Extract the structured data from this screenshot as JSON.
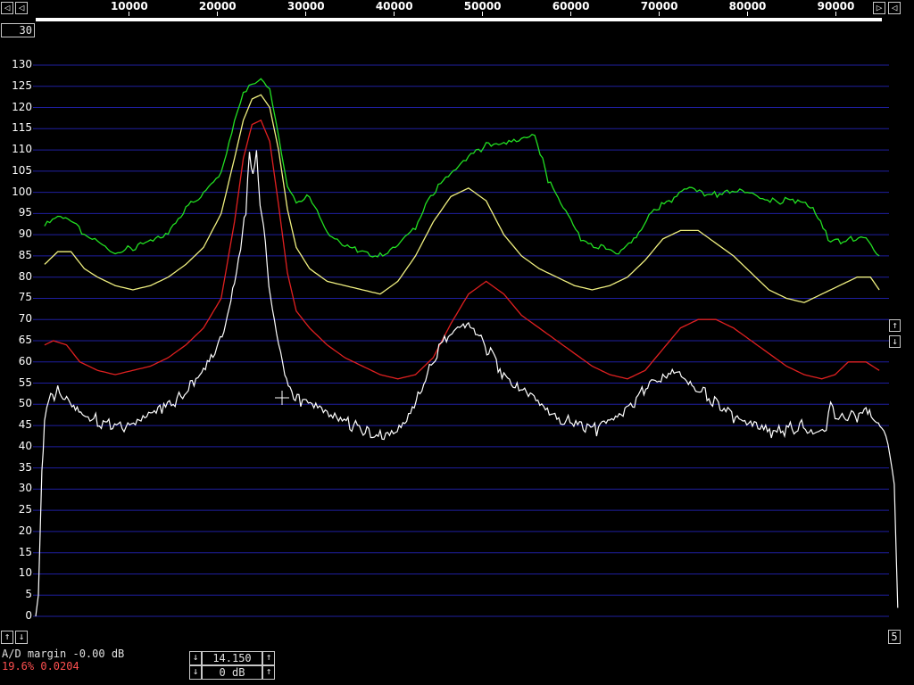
{
  "x_axis": {
    "ticks": [
      "10000",
      "20000",
      "30000",
      "40000",
      "50000",
      "60000",
      "70000",
      "80000",
      "90000"
    ],
    "min": 0,
    "max": 96000
  },
  "y_axis": {
    "ticks": [
      "130",
      "125",
      "120",
      "115",
      "110",
      "105",
      "100",
      "95",
      "90",
      "85",
      "80",
      "75",
      "70",
      "65",
      "60",
      "55",
      "50",
      "45",
      "40",
      "35",
      "30",
      "25",
      "20",
      "15",
      "10",
      "5",
      "0"
    ],
    "min": 0,
    "max": 130
  },
  "toolbar": {
    "left_arrow": "◁",
    "right_arrow": "▷",
    "scroll_left": "◁",
    "zoom_label": "30",
    "up_arrow": "↑",
    "down_arrow": "↓",
    "bottom_right_label": "5"
  },
  "status": {
    "line1": "A/D margin -0.00 dB",
    "line2": "19.6% 0.0204"
  },
  "controls": {
    "value1": "14.150",
    "value2": "0 dB"
  },
  "colors": {
    "grid": "#1f1fa0",
    "green": "#22e022",
    "yellow": "#f0f080",
    "red": "#e02020",
    "white": "#ffffff"
  },
  "chart_data": {
    "type": "line",
    "xlim": [
      0,
      96000
    ],
    "ylim": [
      0,
      130
    ],
    "grid": true,
    "series": [
      {
        "color": "#22e022",
        "x": [
          1000,
          2500,
          4000,
          5500,
          7000,
          9000,
          11000,
          13000,
          15000,
          17000,
          19000,
          21000,
          22500,
          23500,
          24500,
          25500,
          26500,
          27500,
          28500,
          29500,
          31000,
          33000,
          35000,
          37000,
          39000,
          41000,
          43000,
          45000,
          47000,
          49000,
          51000,
          53000,
          55000,
          56500,
          58000,
          60000,
          62000,
          64000,
          66000,
          68000,
          70000,
          72000,
          74000,
          76000,
          78000,
          80000,
          82000,
          84000,
          86000,
          88000,
          90000,
          92000,
          94000,
          95500
        ],
        "y": [
          92,
          94,
          93,
          90,
          89,
          86,
          87,
          88,
          90,
          96,
          100,
          105,
          117,
          124,
          125,
          126,
          124,
          113,
          102,
          98,
          99,
          90,
          87,
          86,
          85,
          88,
          92,
          100,
          104,
          108,
          111,
          112,
          113,
          114,
          103,
          95,
          88,
          87,
          86,
          90,
          96,
          98,
          101,
          99,
          100,
          101,
          99,
          98,
          98,
          96,
          88,
          89,
          90,
          85
        ]
      },
      {
        "color": "#f0f080",
        "x": [
          1000,
          2500,
          4000,
          5500,
          7000,
          9000,
          11000,
          13000,
          15000,
          17000,
          19000,
          21000,
          22500,
          23500,
          24500,
          25500,
          26500,
          27500,
          28500,
          29500,
          31000,
          33000,
          35000,
          37000,
          39000,
          41000,
          43000,
          45000,
          47000,
          49000,
          51000,
          53000,
          55000,
          57000,
          59000,
          61000,
          63000,
          65000,
          67000,
          69000,
          71000,
          73000,
          75000,
          77000,
          79000,
          81000,
          83000,
          85000,
          87000,
          89000,
          91000,
          93000,
          94500,
          95500
        ],
        "y": [
          83,
          86,
          86,
          82,
          80,
          78,
          77,
          78,
          80,
          83,
          87,
          95,
          108,
          117,
          122,
          123,
          120,
          110,
          96,
          87,
          82,
          79,
          78,
          77,
          76,
          79,
          85,
          93,
          99,
          101,
          98,
          90,
          85,
          82,
          80,
          78,
          77,
          78,
          80,
          84,
          89,
          91,
          91,
          88,
          85,
          81,
          77,
          75,
          74,
          76,
          78,
          80,
          80,
          77
        ]
      },
      {
        "color": "#e02020",
        "x": [
          1000,
          2000,
          3500,
          5000,
          7000,
          9000,
          11000,
          13000,
          15000,
          17000,
          19000,
          21000,
          22500,
          23500,
          24500,
          25500,
          26500,
          27500,
          28500,
          29500,
          31000,
          33000,
          35000,
          37000,
          39000,
          41000,
          43000,
          45000,
          47000,
          49000,
          51000,
          53000,
          55000,
          57000,
          59000,
          61000,
          63000,
          65000,
          67000,
          69000,
          71000,
          73000,
          75000,
          77000,
          79000,
          81000,
          83000,
          85000,
          87000,
          89000,
          90500,
          92000,
          94000,
          95500
        ],
        "y": [
          64,
          65,
          64,
          60,
          58,
          57,
          58,
          59,
          61,
          64,
          68,
          75,
          93,
          108,
          116,
          117,
          112,
          97,
          81,
          72,
          68,
          64,
          61,
          59,
          57,
          56,
          57,
          61,
          69,
          76,
          79,
          76,
          71,
          68,
          65,
          62,
          59,
          57,
          56,
          58,
          63,
          68,
          70,
          70,
          68,
          65,
          62,
          59,
          57,
          56,
          57,
          60,
          60,
          58
        ]
      },
      {
        "color": "#ffffff",
        "x": [
          0,
          300,
          700,
          1000,
          1500,
          2500,
          3500,
          4500,
          5500,
          7000,
          8500,
          10000,
          11500,
          13000,
          14500,
          16000,
          17500,
          19000,
          20500,
          21500,
          22500,
          23200,
          23800,
          24200,
          24600,
          25000,
          25400,
          25800,
          26200,
          26800,
          27500,
          28200,
          29000,
          30000,
          31500,
          33000,
          34500,
          36000,
          37500,
          39000,
          40500,
          42000,
          43500,
          45000,
          46500,
          48000,
          49000,
          50000,
          51500,
          53000,
          54500,
          56000,
          57500,
          59000,
          60500,
          62000,
          63500,
          65000,
          66500,
          68000,
          69500,
          71000,
          72500,
          73500,
          74500,
          76000,
          77500,
          79000,
          80500,
          82000,
          83500,
          85000,
          86500,
          88000,
          89500,
          90000,
          90500,
          91500,
          93000,
          94000,
          95000,
          95800,
          96500,
          97200,
          97600
        ],
        "y": [
          0,
          5,
          33,
          45,
          51,
          53,
          52,
          50,
          48,
          46,
          45,
          44,
          45,
          47,
          49,
          51,
          54,
          59,
          64,
          69,
          80,
          88,
          96,
          108,
          103,
          109,
          96,
          92,
          82,
          74,
          65,
          58,
          53,
          51,
          49,
          47,
          46,
          45,
          44,
          43,
          44,
          47,
          53,
          60,
          66,
          67,
          68,
          66,
          62,
          57,
          55,
          53,
          50,
          47,
          46,
          44,
          44,
          45,
          47,
          51,
          55,
          57,
          59,
          57,
          55,
          52,
          49,
          47,
          45,
          44,
          43,
          44,
          45,
          44,
          45,
          52,
          48,
          47,
          47,
          48,
          46,
          44,
          40,
          30,
          2
        ]
      }
    ]
  }
}
